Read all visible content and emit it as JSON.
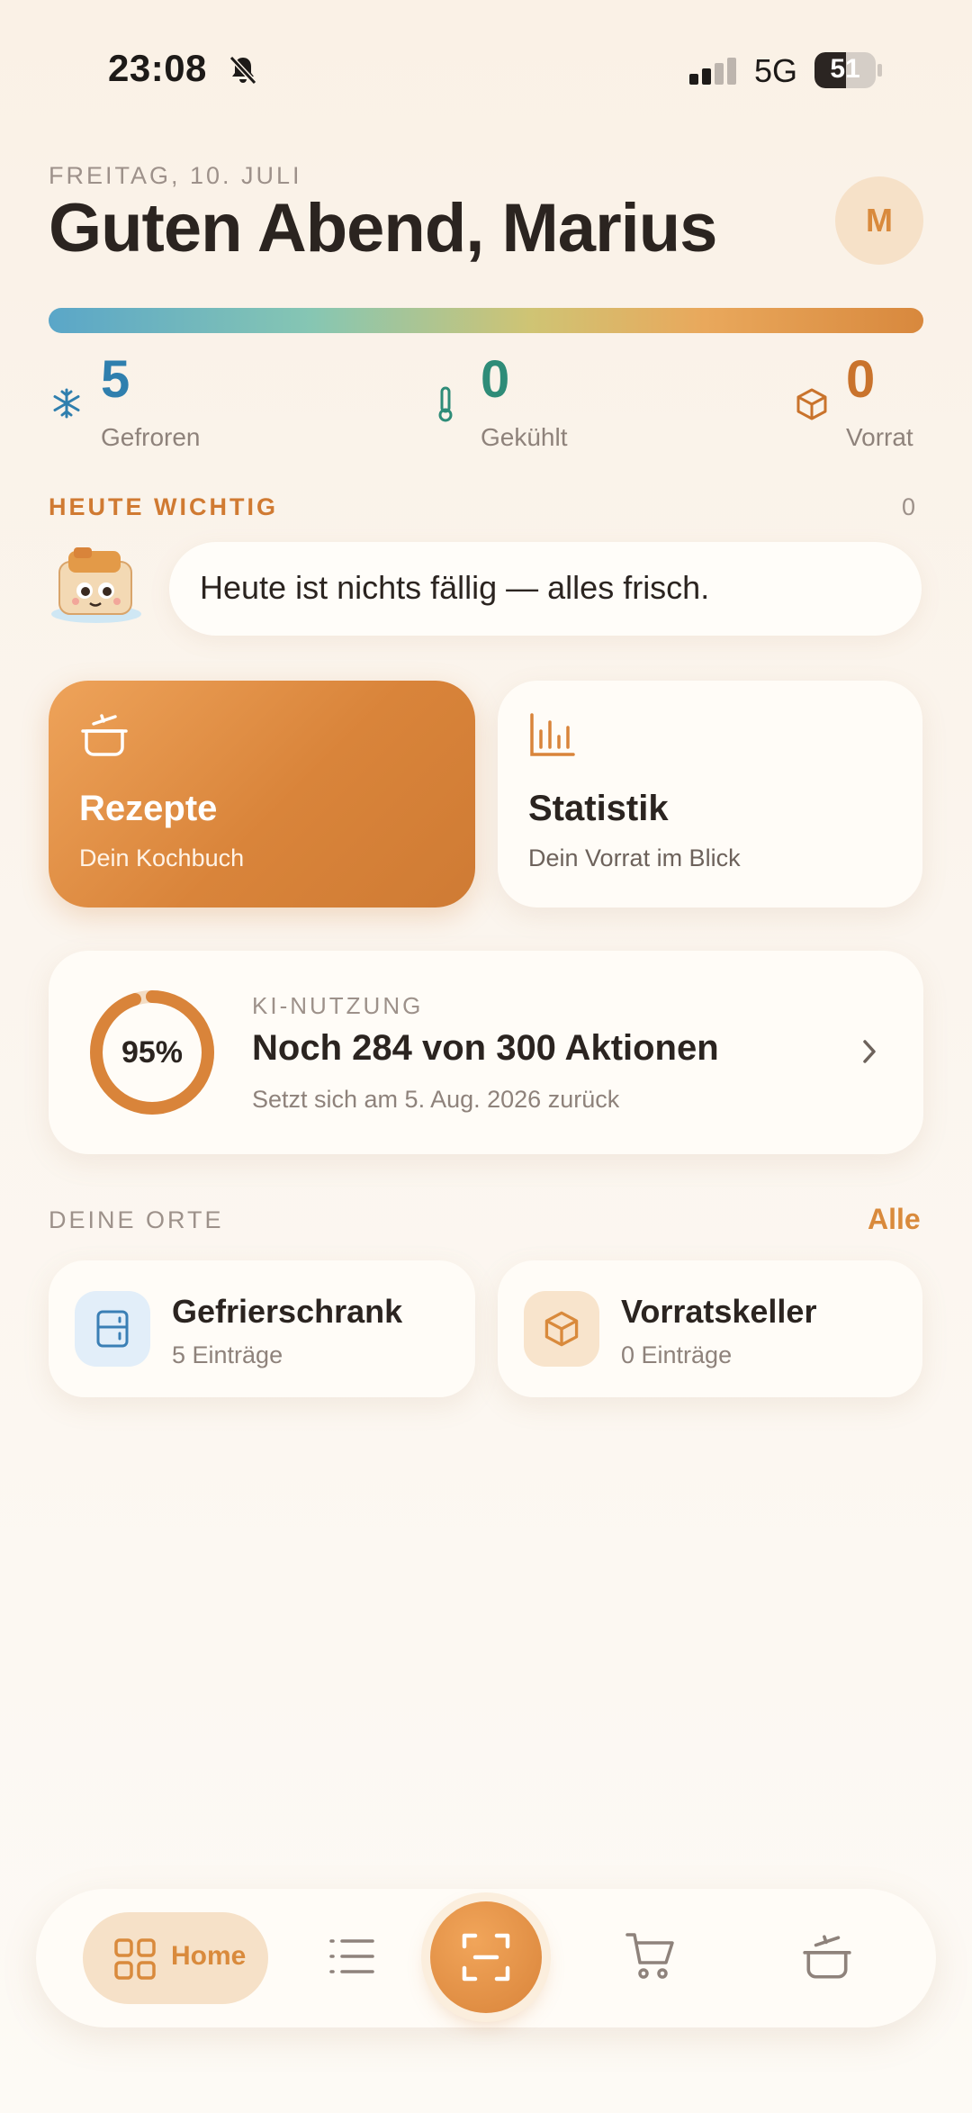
{
  "status_bar": {
    "time": "23:08",
    "network": "5G",
    "battery": "51",
    "battery_level": 0.51
  },
  "header": {
    "date": "FREITAG, 10. JULI",
    "greeting": "Guten Abend, Marius",
    "avatar_initial": "M"
  },
  "stats": [
    {
      "value": "5",
      "label": "Gefroren",
      "color": "#2f7fae",
      "icon": "snowflake-icon"
    },
    {
      "value": "0",
      "label": "Gekühlt",
      "color": "#2e8c78",
      "icon": "thermometer-icon"
    },
    {
      "value": "0",
      "label": "Vorrat",
      "color": "#c9732c",
      "icon": "box-icon"
    }
  ],
  "today": {
    "label": "HEUTE WICHTIG",
    "count": "0",
    "message": "Heute ist nichts fällig — alles frisch.",
    "mascot": "fridge-mascot-icon"
  },
  "tiles": {
    "recipes": {
      "title": "Rezepte",
      "subtitle": "Dein Kochbuch",
      "icon": "pot-icon"
    },
    "statistics": {
      "title": "Statistik",
      "subtitle": "Dein Vorrat im Blick",
      "icon": "bar-chart-icon"
    }
  },
  "ai_usage": {
    "label": "KI-NUTZUNG",
    "percent_text": "95%",
    "percent": 95,
    "title": "Noch 284 von 300 Aktionen",
    "subtitle": "Setzt sich am 5. Aug. 2026 zurück"
  },
  "places": {
    "label": "DEINE ORTE",
    "all_link": "Alle",
    "items": [
      {
        "name": "Gefrierschrank",
        "count": "5 Einträge",
        "icon": "freezer-icon",
        "icon_bg": "#e2eef9",
        "icon_color": "#3a7fb5"
      },
      {
        "name": "Vorratskeller",
        "count": "0 Einträge",
        "icon": "box-icon",
        "icon_bg": "#f8e4cc",
        "icon_color": "#d98a3c"
      }
    ]
  },
  "nav": {
    "home_label": "Home",
    "items": [
      "home-icon",
      "list-icon",
      "scan-icon",
      "cart-icon",
      "pot-icon"
    ]
  },
  "colors": {
    "accent": "#d98a3c",
    "text": "#2b2420",
    "muted": "#8e827b",
    "background": "#faf1e6"
  }
}
